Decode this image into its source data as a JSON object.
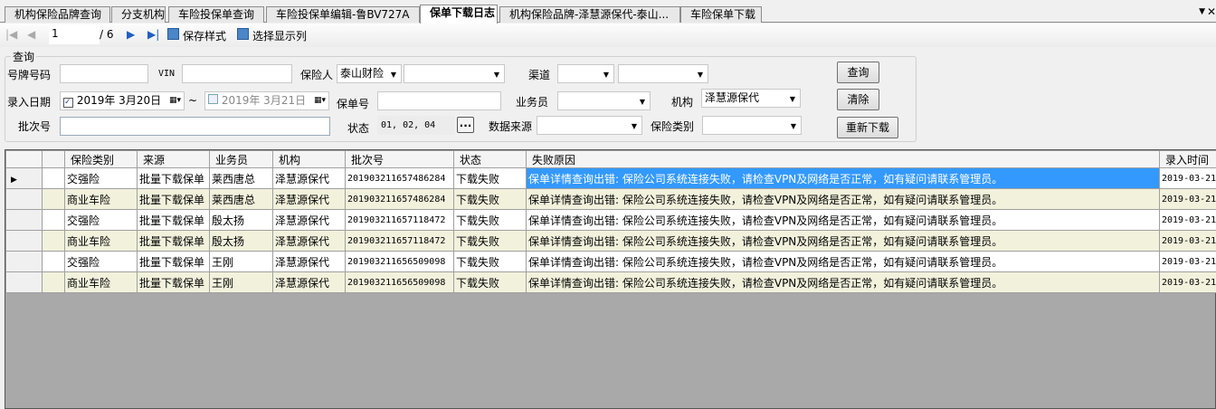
{
  "tabs": [
    "机构保险品牌查询",
    "分支机构",
    "车险投保单查询",
    "车险投保单编辑-鲁BV727A",
    "保单下载日志",
    "机构保险品牌-泽慧源保代-泰山...",
    "车险保单下载"
  ],
  "active_tab": 4,
  "toolbar": {
    "page": "1",
    "total": "/ 6",
    "save_style": "保存样式",
    "select_columns": "选择显示列"
  },
  "query": {
    "group_title": "查询",
    "plate_label": "号牌号码",
    "vin_label": "VIN",
    "insurer_label": "保险人",
    "insurer_value": "泰山财险",
    "channel_label": "渠道",
    "date_label": "录入日期",
    "date_from": "2019年  3月20日",
    "date_sep": "~",
    "date_to": "2019年  3月21日",
    "policy_no_label": "保单号",
    "salesman_label": "业务员",
    "org_label": "机构",
    "org_value": "泽慧源保代",
    "batch_label": "批次号",
    "status_label": "状态",
    "status_value": "01, 02, 04",
    "ellipsis": "...",
    "datasource_label": "数据来源",
    "ins_type_label": "保险类别",
    "search_btn": "查询",
    "clear_btn": "清除",
    "redownload_btn": "重新下载"
  },
  "grid": {
    "columns": [
      "保险类别",
      "来源",
      "业务员",
      "机构",
      "批次号",
      "状态",
      "失败原因",
      "录入时间"
    ],
    "rows": [
      [
        "交强险",
        "批量下载保单",
        "莱西唐总",
        "泽慧源保代",
        "201903211657486284",
        "下载失败",
        "保单详情查询出错: 保险公司系统连接失败，请检查VPN及网络是否正常，如有疑问请联系管理员。",
        "2019-03-21"
      ],
      [
        "商业车险",
        "批量下载保单",
        "莱西唐总",
        "泽慧源保代",
        "201903211657486284",
        "下载失败",
        "保单详情查询出错: 保险公司系统连接失败，请检查VPN及网络是否正常，如有疑问请联系管理员。",
        "2019-03-21"
      ],
      [
        "交强险",
        "批量下载保单",
        "殷太扬",
        "泽慧源保代",
        "201903211657118472",
        "下载失败",
        "保单详情查询出错: 保险公司系统连接失败，请检查VPN及网络是否正常，如有疑问请联系管理员。",
        "2019-03-21"
      ],
      [
        "商业车险",
        "批量下载保单",
        "殷太扬",
        "泽慧源保代",
        "201903211657118472",
        "下载失败",
        "保单详情查询出错: 保险公司系统连接失败，请检查VPN及网络是否正常，如有疑问请联系管理员。",
        "2019-03-21"
      ],
      [
        "交强险",
        "批量下载保单",
        "王刚",
        "泽慧源保代",
        "201903211656509098",
        "下载失败",
        "保单详情查询出错: 保险公司系统连接失败，请检查VPN及网络是否正常，如有疑问请联系管理员。",
        "2019-03-21"
      ],
      [
        "商业车险",
        "批量下载保单",
        "王刚",
        "泽慧源保代",
        "201903211656509098",
        "下载失败",
        "保单详情查询出错: 保险公司系统连接失败，请检查VPN及网络是否正常，如有疑问请联系管理员。",
        "2019-03-21"
      ]
    ]
  }
}
